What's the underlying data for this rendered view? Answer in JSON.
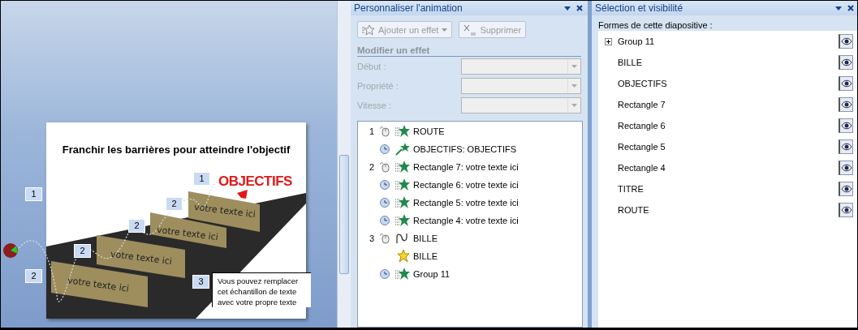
{
  "slide": {
    "title": "Franchir les barrières pour atteindre  l'objectif",
    "goal": "OBJECTIFS",
    "boards": [
      "votre texte ici",
      "votre texte ici",
      "votre texte  ici",
      "votre texte ici"
    ],
    "note": [
      "Vous pouvez remplacer",
      "cet échantillon de texte",
      "avec votre propre texte"
    ],
    "tags": [
      "1",
      "2",
      "2",
      "2",
      "2",
      "1",
      "3"
    ]
  },
  "animation_pane": {
    "title": "Personnaliser l'animation",
    "buttons": [
      {
        "label": "Ajouter un effet",
        "kind": "add",
        "disabled": true
      },
      {
        "label": "Supprimer",
        "kind": "delete",
        "disabled": true
      }
    ],
    "section": "Modifier un effet",
    "fields": [
      {
        "label": "Début :",
        "disabled": true
      },
      {
        "label": "Propriété :",
        "disabled": true
      },
      {
        "label": "Vitesse :",
        "disabled": true
      }
    ],
    "items": [
      {
        "number": "1",
        "trigger": {
          "kind": "click"
        },
        "effect": {
          "kind": "entrance"
        },
        "label": "ROUTE"
      },
      {
        "trigger": {
          "kind": "after"
        },
        "effect": {
          "kind": "fly"
        },
        "label": "OBJECTIFS: OBJECTIFS"
      },
      {
        "number": "2",
        "trigger": {
          "kind": "click"
        },
        "effect": {
          "kind": "entrance"
        },
        "label": "Rectangle 7: votre texte ici"
      },
      {
        "trigger": {
          "kind": "after"
        },
        "effect": {
          "kind": "entrance"
        },
        "label": "Rectangle 6: votre texte ici"
      },
      {
        "trigger": {
          "kind": "after"
        },
        "effect": {
          "kind": "entrance"
        },
        "label": "Rectangle 5: votre texte ici"
      },
      {
        "trigger": {
          "kind": "after"
        },
        "effect": {
          "kind": "entrance"
        },
        "label": "Rectangle 4: votre texte ici"
      },
      {
        "number": "3",
        "trigger": {
          "kind": "click"
        },
        "effect": {
          "kind": "path"
        },
        "label": "BILLE"
      },
      {
        "trigger": {
          "kind": "with"
        },
        "effect": {
          "kind": "emphasis"
        },
        "label": "BILLE"
      },
      {
        "trigger": {
          "kind": "after"
        },
        "effect": {
          "kind": "entrance"
        },
        "label": "Group 11"
      }
    ]
  },
  "selection_pane": {
    "title": "Sélection et visibilité",
    "subtitle": "Formes de cette diapositive :",
    "shapes": [
      {
        "name": "Group 11",
        "kind": "group",
        "expanded": false,
        "visible": true
      },
      {
        "name": "BILLE",
        "kind": "shape",
        "visible": true
      },
      {
        "name": "OBJECTIFS",
        "kind": "shape",
        "visible": true
      },
      {
        "name": "Rectangle 7",
        "kind": "shape",
        "visible": true
      },
      {
        "name": "Rectangle 6",
        "kind": "shape",
        "visible": true
      },
      {
        "name": "Rectangle 5",
        "kind": "shape",
        "visible": true
      },
      {
        "name": "Rectangle 4",
        "kind": "shape",
        "visible": true
      },
      {
        "name": "TITRE",
        "kind": "shape",
        "visible": true
      },
      {
        "name": "ROUTE",
        "kind": "shape",
        "visible": true
      }
    ]
  }
}
